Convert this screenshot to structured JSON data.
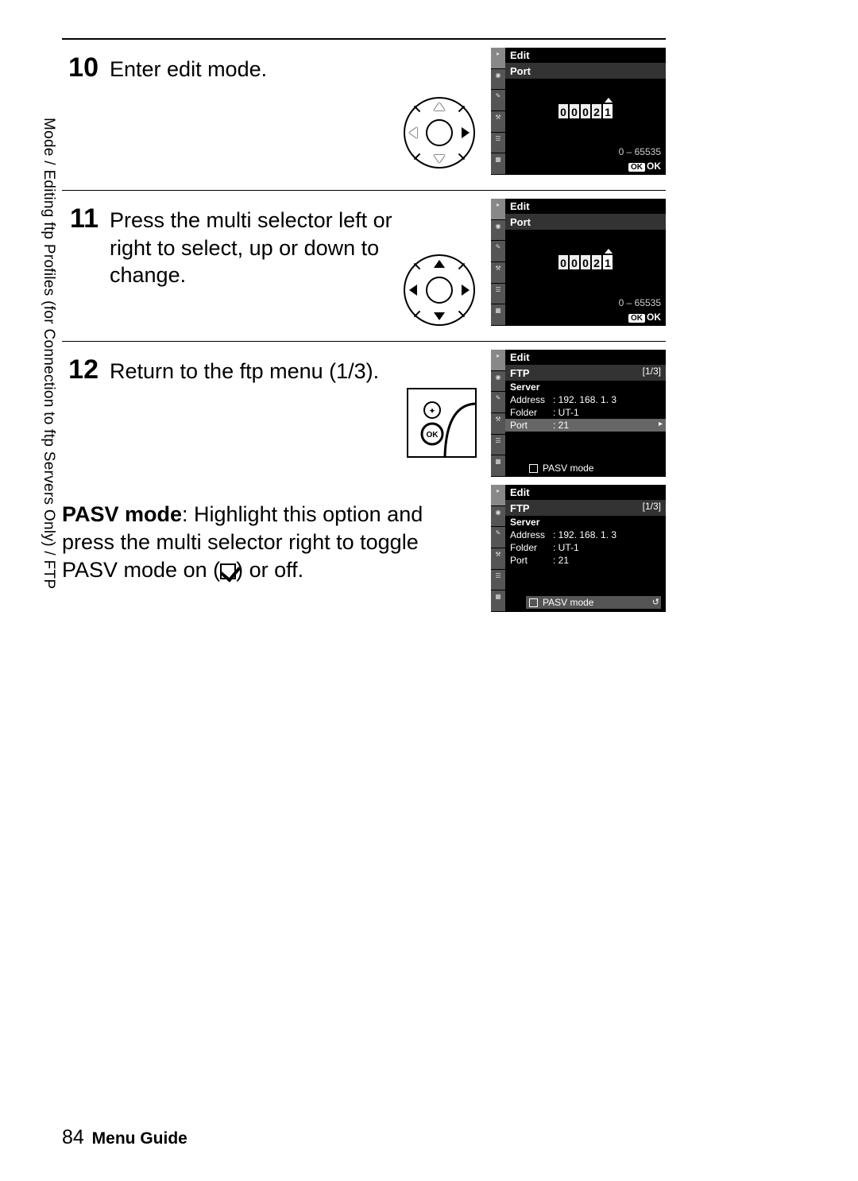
{
  "sidebar_label": "Mode / Editing ftp Profiles (for Connection to ftp Servers Only) / FTP",
  "steps": {
    "s10": {
      "num": "10",
      "text": "Enter edit mode."
    },
    "s11": {
      "num": "11",
      "text": "Press the multi selector left or right to select, up or down to change."
    },
    "s12": {
      "num": "12",
      "text": "Return to the ftp menu (1/3)."
    }
  },
  "pasv_para_strong": "PASV mode",
  "pasv_para_rest_a": ": Highlight this option and press the multi selector right to toggle PASV mode on (",
  "pasv_para_rest_b": ") or off.",
  "screen_port": {
    "title": "Edit",
    "sub": "Port",
    "digits": [
      "0",
      "0",
      "0",
      "2",
      "1"
    ],
    "range": "0 – 65535",
    "ok": "OK"
  },
  "screen_ftp": {
    "title": "Edit",
    "sub": "FTP",
    "page": "[1/3]",
    "server": "Server",
    "address_label": "Address",
    "address_value": ": 192. 168. 1. 3",
    "folder_label": "Folder",
    "folder_value": ": UT-1",
    "port_label": "Port",
    "port_value": ": 21",
    "pasv": "PASV mode"
  },
  "footer": {
    "page": "84",
    "title": "Menu Guide"
  }
}
